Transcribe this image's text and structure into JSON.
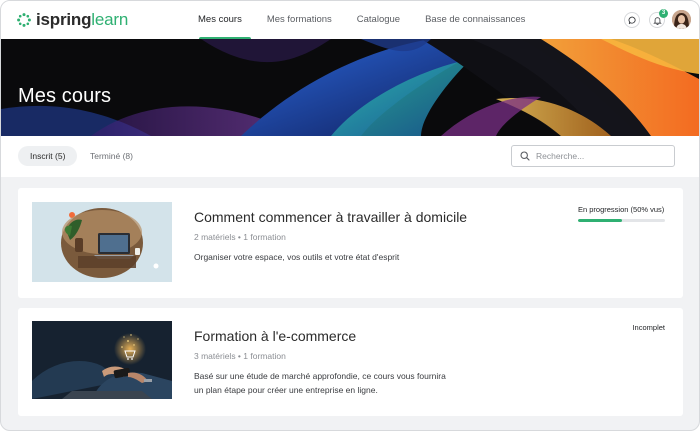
{
  "header": {
    "logo": {
      "part1": "ispring",
      "part2": "learn"
    },
    "nav": [
      {
        "label": "Mes cours",
        "active": true
      },
      {
        "label": "Mes formations",
        "active": false
      },
      {
        "label": "Catalogue",
        "active": false
      },
      {
        "label": "Base de connaissances",
        "active": false
      }
    ],
    "notifications_count": "3",
    "icons": {
      "chat": "chat-icon",
      "bell": "bell-icon",
      "avatar": "user-avatar"
    }
  },
  "banner": {
    "title": "Mes cours"
  },
  "filters": {
    "tabs": [
      {
        "label": "Inscrit (5)",
        "active": true
      },
      {
        "label": "Terminé (8)",
        "active": false
      }
    ],
    "search": {
      "placeholder": "Recherche...",
      "value": ""
    }
  },
  "courses": [
    {
      "title": "Comment commencer à travailler à domicile",
      "meta": "2 matériels • 1 formation",
      "description": "Organiser votre espace, vos outils et votre état d'esprit",
      "status": "En progression (50% vus)",
      "progress": 0.5
    },
    {
      "title": "Formation à l'e-commerce",
      "meta": "3 matériels • 1 formation",
      "description_lines": [
        "Basé sur une étude de marché approfondie, ce cours vous fournira",
        "un plan étape pour créer une entreprise en ligne."
      ],
      "status": "Incomplet"
    }
  ],
  "colors": {
    "accent": "#2fb072",
    "page_bg": "#f1f2f4",
    "banner_bg": "#0a0a0c"
  }
}
